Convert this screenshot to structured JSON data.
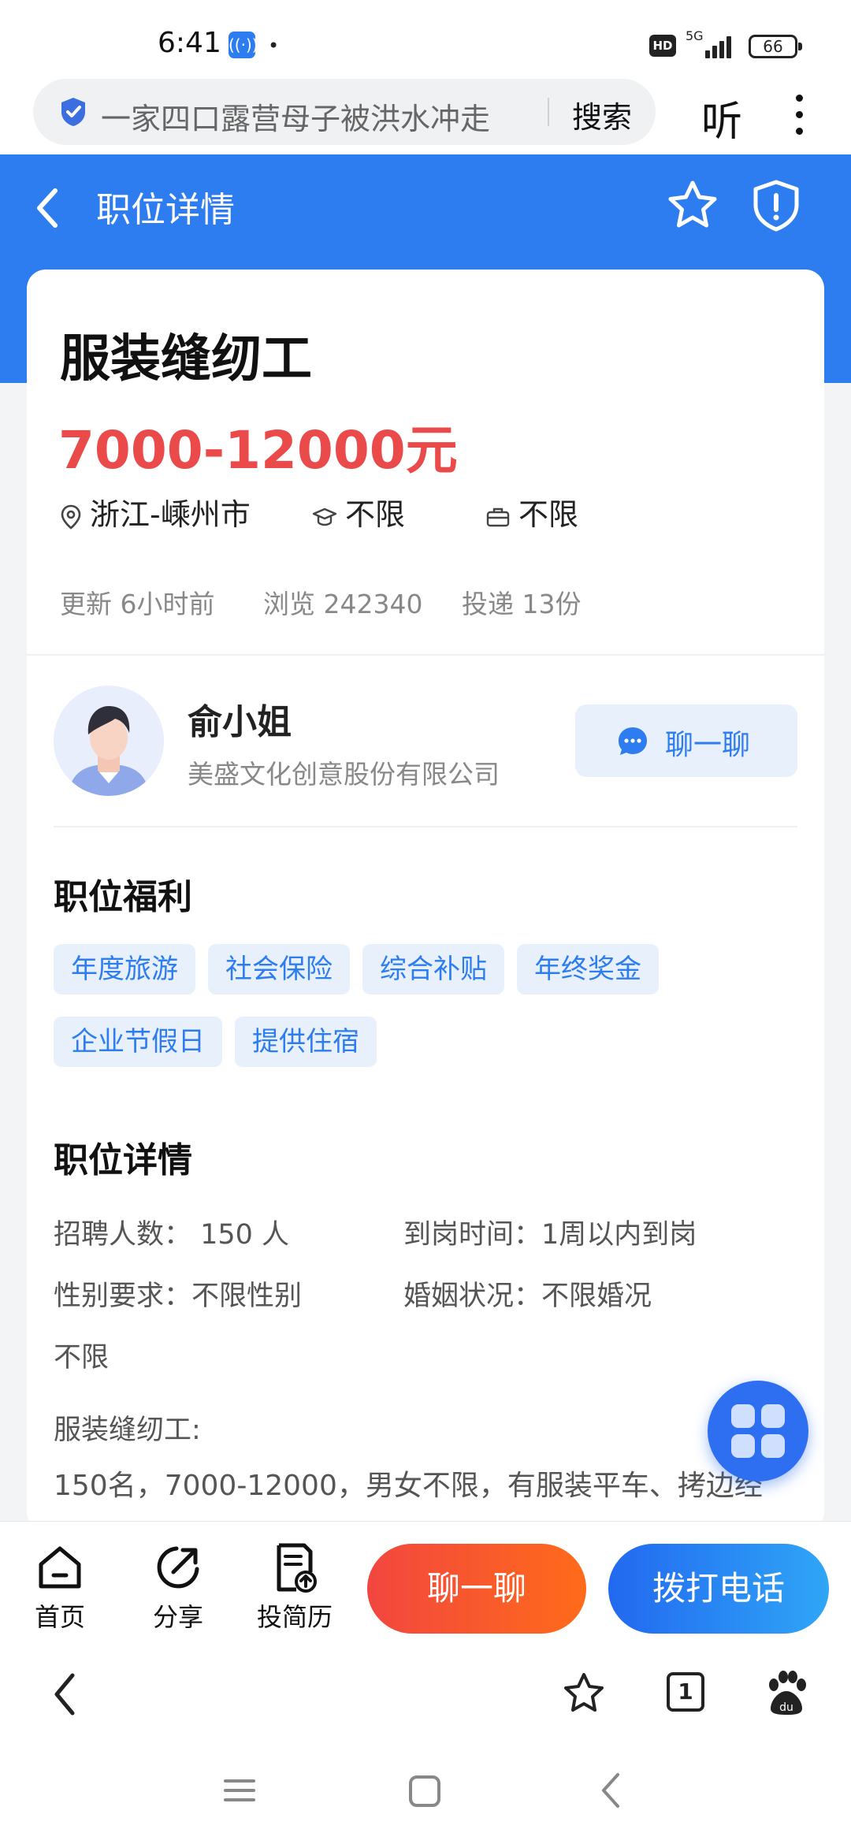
{
  "status_bar": {
    "time": "6:41",
    "dot": "•",
    "hd": "HD",
    "network": "5G",
    "battery": "66"
  },
  "search": {
    "query": "一家四口露营母子被洪水冲走",
    "search_label": "搜索",
    "listen_label": "听"
  },
  "header": {
    "title": "职位详情"
  },
  "job": {
    "title": "服装缝纫工",
    "salary": "7000-12000元",
    "location": "浙江-嵊州市",
    "education": "不限",
    "experience": "不限",
    "updated": "更新 6小时前",
    "views": "浏览 242340",
    "applications": "投递 13份"
  },
  "recruiter": {
    "name": "俞小姐",
    "company": "美盛文化创意股份有限公司",
    "chat_label": "聊一聊"
  },
  "benefits": {
    "title": "职位福利",
    "tags": [
      "年度旅游",
      "社会保险",
      "综合补贴",
      "年终奖金",
      "企业节假日",
      "提供住宿"
    ]
  },
  "details": {
    "title": "职位详情",
    "headcount": "招聘人数： 150 人",
    "start_time": "到岗时间：1周以内到岗",
    "gender": "性别要求：不限性别",
    "marital": "婚姻状况：不限婚况",
    "other": "不限",
    "desc_heading": "服装缝纫工:",
    "desc_line": "150名，7000-12000，男女不限，有服装平车、拷边经"
  },
  "action_bar": {
    "home_label": "首页",
    "share_label": "分享",
    "resume_label": "投简历",
    "chat_label": "聊一聊",
    "call_label": "拨打电话"
  },
  "browser": {
    "tab_count": "1"
  },
  "colors": {
    "brand_blue": "#2d7cf0",
    "salary_red": "#ea4a4a",
    "chat_orange": "#ff6b1a"
  }
}
